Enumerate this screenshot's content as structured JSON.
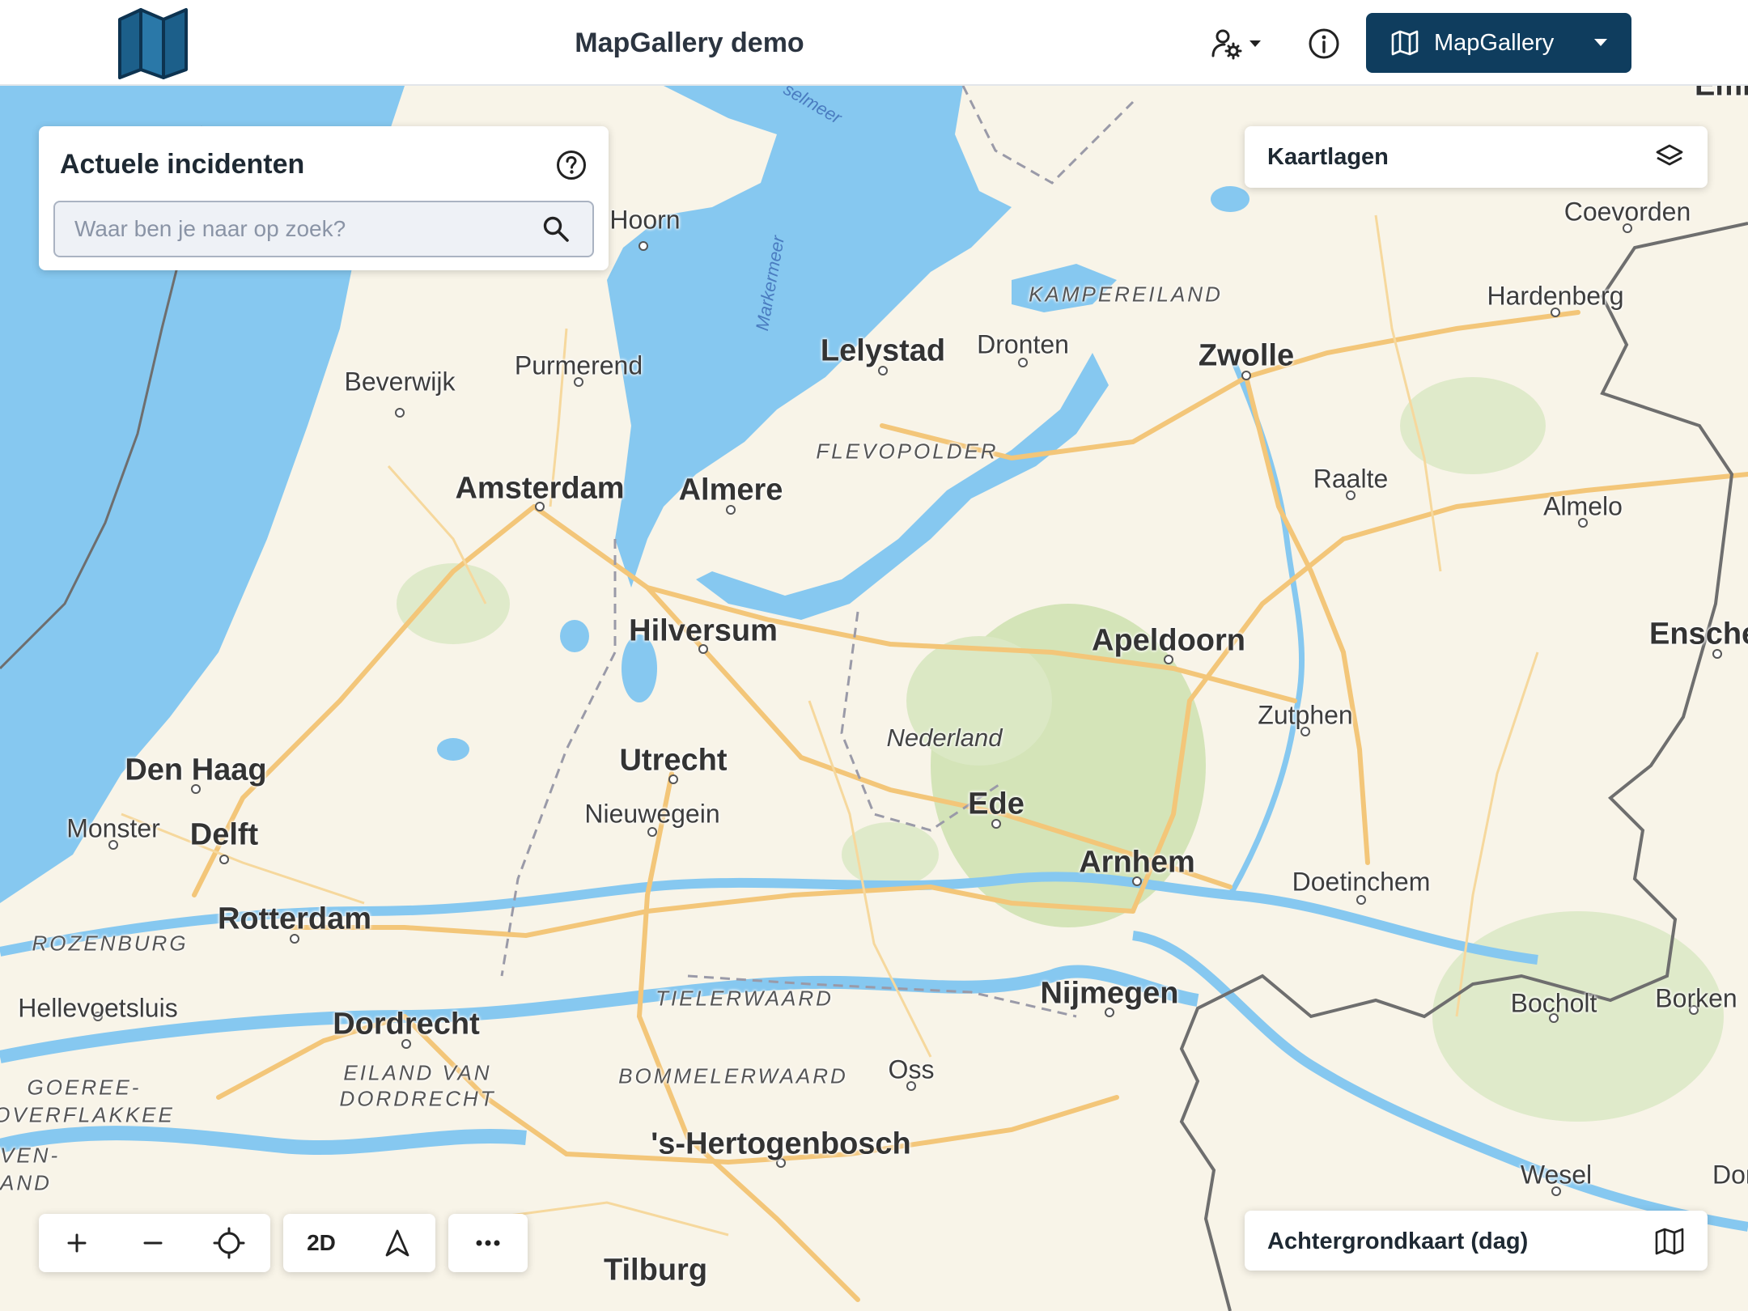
{
  "header": {
    "title": "MapGallery demo",
    "gallery_button_label": "MapGallery"
  },
  "incidents_panel": {
    "title": "Actuele incidenten",
    "search_placeholder": "Waar ben je naar op zoek?"
  },
  "layers_panel": {
    "label": "Kaartlagen"
  },
  "basemap_panel": {
    "label": "Achtergrondkaart (dag)"
  },
  "map_controls": {
    "zoom_in": "+",
    "zoom_out": "−",
    "view_mode": "2D",
    "more": "···"
  },
  "map": {
    "colors": {
      "water": "#86c8f0",
      "land": "#f8f4e8",
      "forest": "#d4e4b8",
      "road": "#f3c679",
      "border": "#777777"
    },
    "labels": {
      "amsterdam": "Amsterdam",
      "almere": "Almere",
      "lelystad": "Lelystad",
      "dronten": "Dronten",
      "zwolle": "Zwolle",
      "hoorn": "Hoorn",
      "purmerend": "Purmerend",
      "beverwijk": "Beverwijk",
      "hilversum": "Hilversum",
      "utrecht": "Utrecht",
      "nieuwegein": "Nieuwegein",
      "den_haag": "Den Haag",
      "delft": "Delft",
      "monster": "Monster",
      "rotterdam": "Rotterdam",
      "hellevoetsluis": "Hellevoetsluis",
      "dordrecht": "Dordrecht",
      "hertogenbosch": "'s-Hertogenbosch",
      "tilburg": "Tilburg",
      "oss": "Oss",
      "nijmegen": "Nijmegen",
      "arnhem": "Arnhem",
      "ede": "Ede",
      "apeldoorn": "Apeldoorn",
      "zutphen": "Zutphen",
      "doetinchem": "Doetinchem",
      "raalte": "Raalte",
      "almelo": "Almelo",
      "coevorden": "Coevorden",
      "hardenberg": "Hardenberg",
      "enschede": "Ensche",
      "bocholt": "Bocholt",
      "borken": "Borken",
      "wesel": "Wesel",
      "emmen": "Emme",
      "dor": "Dor",
      "nederland": "Nederland",
      "flevopolder": "FLEVOPOLDER",
      "kampereiland": "KAMPEREILAND",
      "rozenburg": "ROZENBURG",
      "tielerwaard": "TIELERWAARD",
      "bommelerwaard": "BOMMELERWAARD",
      "eiland_van_dordrecht_1": "EILAND VAN",
      "eiland_van_dordrecht_2": "DORDRECHT",
      "goeree_1": "GOEREE-",
      "goeree_2": "OVERFLAKKEE",
      "voorne_1": "VEN-",
      "voorne_2": "AND",
      "markermeer": "Markermeer",
      "ijsselmeer": "selmeer"
    }
  }
}
